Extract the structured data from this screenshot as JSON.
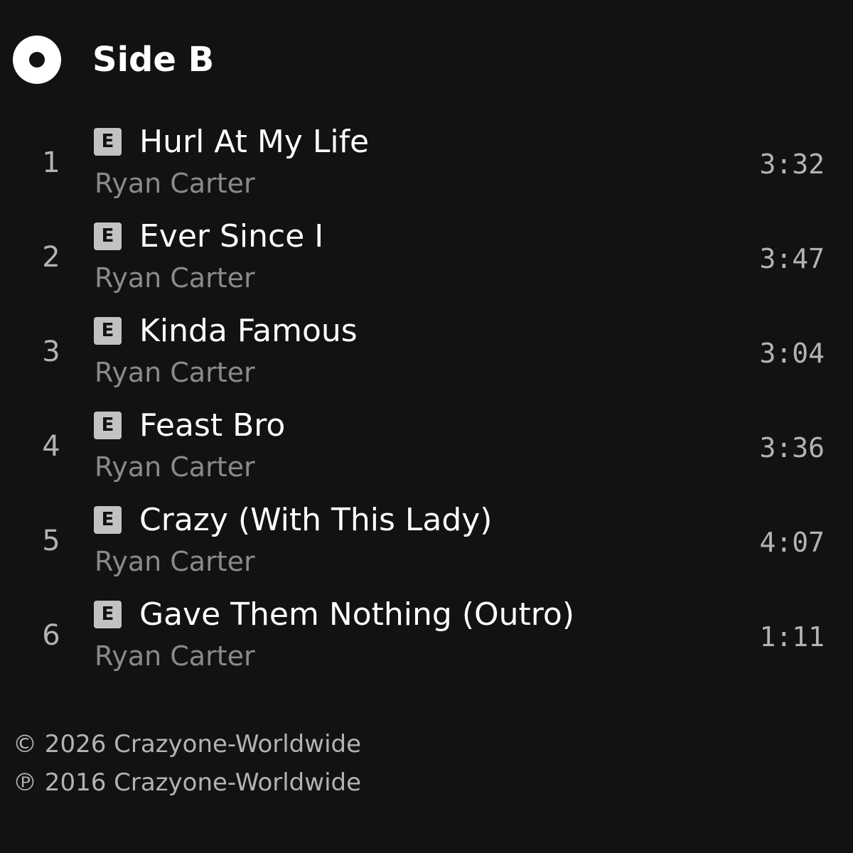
{
  "section": {
    "icon": "disc-icon",
    "title": "Side B"
  },
  "tracks": [
    {
      "number": "1",
      "explicit": "E",
      "title": "Hurl At My Life",
      "artist": "Ryan Carter",
      "duration": "3:32"
    },
    {
      "number": "2",
      "explicit": "E",
      "title": "Ever Since I",
      "artist": "Ryan Carter",
      "duration": "3:47"
    },
    {
      "number": "3",
      "explicit": "E",
      "title": "Kinda Famous",
      "artist": "Ryan Carter",
      "duration": "3:04"
    },
    {
      "number": "4",
      "explicit": "E",
      "title": "Feast Bro",
      "artist": "Ryan Carter",
      "duration": "3:36"
    },
    {
      "number": "5",
      "explicit": "E",
      "title": "Crazy (With This Lady)",
      "artist": "Ryan Carter",
      "duration": "4:07"
    },
    {
      "number": "6",
      "explicit": "E",
      "title": "Gave Them Nothing (Outro)",
      "artist": "Ryan Carter",
      "duration": "1:11"
    }
  ],
  "footer": {
    "copyright": "© 2026 Crazyone-Worldwide",
    "phonographic": "℗ 2016 Crazyone-Worldwide"
  },
  "colors": {
    "background": "#121212",
    "primary_text": "#ffffff",
    "secondary_text": "#8a8a8a",
    "explicit_badge": "#c2c2c2"
  }
}
